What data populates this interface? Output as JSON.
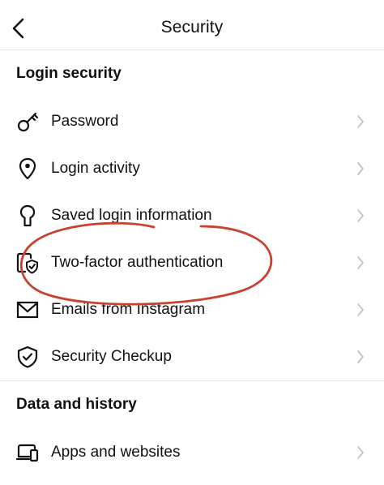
{
  "header": {
    "title": "Security",
    "back_icon": "chevron-left-icon"
  },
  "sections": [
    {
      "title": "Login security",
      "items": [
        {
          "label": "Password",
          "icon": "key-icon"
        },
        {
          "label": "Login activity",
          "icon": "location-pin-icon"
        },
        {
          "label": "Saved login information",
          "icon": "keyhole-icon"
        },
        {
          "label": "Two-factor authentication",
          "icon": "device-shield-icon"
        },
        {
          "label": "Emails from Instagram",
          "icon": "envelope-icon"
        },
        {
          "label": "Security Checkup",
          "icon": "shield-check-icon"
        }
      ]
    },
    {
      "title": "Data and history",
      "items": [
        {
          "label": "Apps and websites",
          "icon": "devices-icon"
        }
      ]
    }
  ],
  "colors": {
    "text": "#111111",
    "chevron": "#c4c4c4",
    "divider": "#e6e6e6",
    "annotation": "#c8422f"
  }
}
